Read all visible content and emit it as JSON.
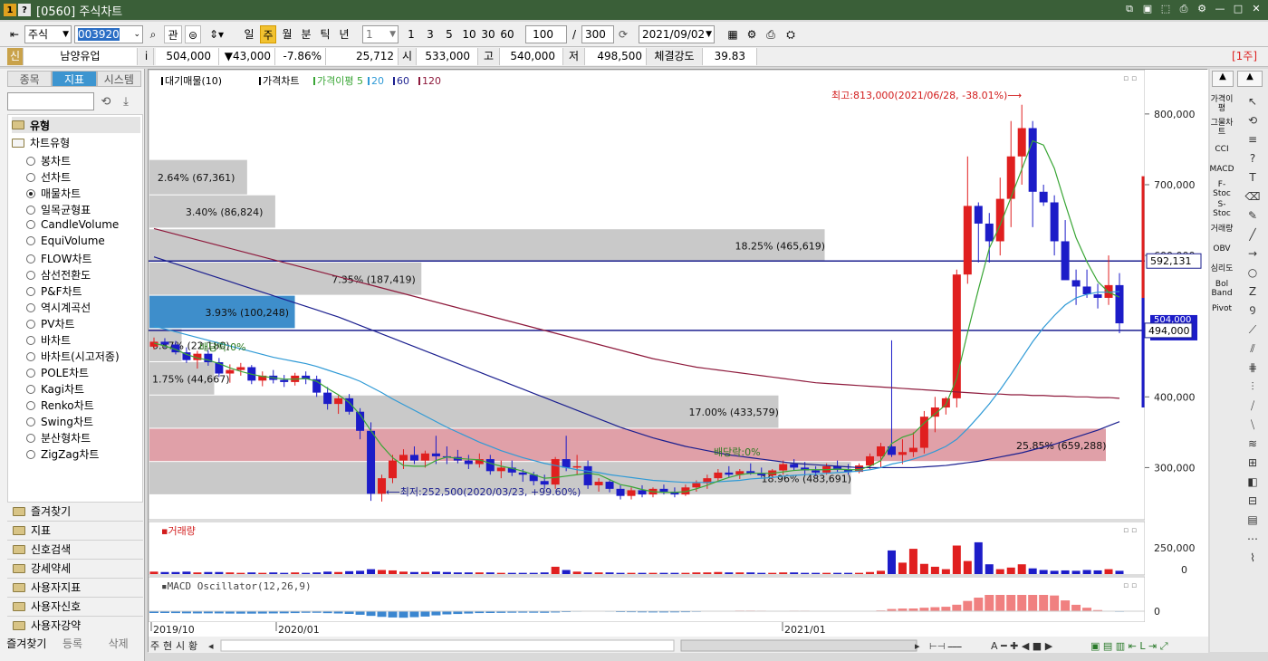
{
  "window": {
    "title": "[0560] 주식차트",
    "num_icons": [
      "1",
      "?"
    ]
  },
  "toolbar": {
    "type_select": "주식",
    "code": "003920",
    "btn_gwan": "관",
    "periods": [
      "일",
      "주",
      "월",
      "분",
      "틱",
      "년"
    ],
    "active_period": "주",
    "period_value": "1",
    "quick": [
      "1",
      "3",
      "5",
      "10",
      "30",
      "60"
    ],
    "count": "100",
    "slash": "/",
    "total": "300",
    "date": "2021/09/02"
  },
  "quote": {
    "tag": "신",
    "name": "남양유업",
    "info": "i",
    "price": "504,000",
    "change": "▼43,000",
    "change_pct": "-7.86%",
    "volume": "25,712",
    "open_lbl": "시",
    "open": "533,000",
    "high_lbl": "고",
    "high": "540,000",
    "low_lbl": "저",
    "low": "498,500",
    "strength_lbl": "체결강도",
    "strength": "39.83",
    "period_badge": "[1주]"
  },
  "left_panel": {
    "tabs": [
      "종목",
      "지표",
      "시스템"
    ],
    "active_tab": "지표",
    "section": "유형",
    "tree_root": "차트유형",
    "items": [
      "봉차트",
      "선차트",
      "매물차트",
      "일목균형표",
      "CandleVolume",
      "EquiVolume",
      "FLOW차트",
      "삼선전환도",
      "P&F차트",
      "역시계곡선",
      "PV차트",
      "바차트",
      "바차트(시고저종)",
      "POLE차트",
      "Kagi차트",
      "Renko차트",
      "Swing차트",
      "분산형차트",
      "ZigZag차트"
    ],
    "selected": "매물차트",
    "folders": [
      "즐겨찾기",
      "지표",
      "신호검색",
      "강세약세",
      "사용자지표",
      "사용자신호",
      "사용자강약"
    ],
    "bottom": [
      "즐겨찾기",
      "등록",
      "삭제"
    ]
  },
  "chart_data": {
    "type": "candlestick",
    "legend": {
      "items": [
        "대기매물(10)",
        "가격차트",
        "가격이평 5",
        "20",
        "60",
        "120"
      ],
      "colors": [
        "#000",
        "#000",
        "#3aa636",
        "#2f9ad6",
        "#1b1f8f",
        "#8e1a3c"
      ]
    },
    "y_ticks": [
      "800,000",
      "700,000",
      "600,000",
      "400,000",
      "300,000"
    ],
    "x_ticks": [
      "2019/10",
      "2020/01",
      "2021/01"
    ],
    "price_range": [
      225000,
      860000
    ],
    "annotations": {
      "high": "최고:813,000(2021/06/28, -38.01%)⟶",
      "low": "⟵최저:252,500(2020/03/23, +99.60%)",
      "div1": "배당락:0%",
      "div2": "배당락:0%"
    },
    "price_markers": {
      "p1": "592,131",
      "p2": "494,000",
      "p3": "504,000",
      "p4": "-7.86%"
    },
    "volume_profile": [
      {
        "label": "2.64% (67,361)",
        "low": 685000,
        "high": 735000,
        "pct": 2.64,
        "color": "#c9c9c9"
      },
      {
        "label": "3.40% (86,824)",
        "low": 638000,
        "high": 685000,
        "pct": 3.4,
        "color": "#c9c9c9"
      },
      {
        "label": "18.25% (465,619)",
        "low": 590000,
        "high": 637000,
        "pct": 18.25,
        "color": "#c9c9c9"
      },
      {
        "label": "7.35% (187,419)",
        "low": 543000,
        "high": 590000,
        "pct": 7.35,
        "color": "#c9c9c9"
      },
      {
        "label": "3.93% (100,248)",
        "low": 496000,
        "high": 543000,
        "pct": 3.93,
        "color": "#3e8ecb"
      },
      {
        "label": "0.87% (22,180)",
        "low": 449000,
        "high": 496000,
        "pct": 0.87,
        "color": "#c9c9c9"
      },
      {
        "label": "1.75% (44,667)",
        "low": 402000,
        "high": 449000,
        "pct": 1.75,
        "color": "#c9c9c9"
      },
      {
        "label": "17.00% (433,579)",
        "low": 355000,
        "high": 402000,
        "pct": 17.0,
        "color": "#c9c9c9"
      },
      {
        "label": "25.85% (659,288)",
        "low": 308000,
        "high": 355000,
        "pct": 25.85,
        "color": "#e0a0a8"
      },
      {
        "label": "18.96% (483,691)",
        "low": 261000,
        "high": 308000,
        "pct": 18.96,
        "color": "#c9c9c9"
      }
    ],
    "candles": [
      [
        471,
        484,
        467,
        478
      ],
      [
        478,
        483,
        469,
        474
      ],
      [
        474,
        479,
        460,
        463
      ],
      [
        463,
        470,
        448,
        452
      ],
      [
        452,
        465,
        440,
        461
      ],
      [
        461,
        466,
        444,
        449
      ],
      [
        449,
        455,
        428,
        433
      ],
      [
        433,
        446,
        420,
        438
      ],
      [
        438,
        448,
        430,
        442
      ],
      [
        442,
        445,
        418,
        423
      ],
      [
        423,
        436,
        415,
        430
      ],
      [
        430,
        438,
        419,
        424
      ],
      [
        424,
        431,
        414,
        421
      ],
      [
        421,
        434,
        416,
        430
      ],
      [
        430,
        436,
        418,
        425
      ],
      [
        425,
        430,
        400,
        406
      ],
      [
        406,
        414,
        382,
        390
      ],
      [
        390,
        402,
        376,
        398
      ],
      [
        398,
        404,
        375,
        379
      ],
      [
        379,
        384,
        340,
        352
      ],
      [
        352,
        364,
        253,
        263
      ],
      [
        263,
        290,
        252,
        285
      ],
      [
        285,
        318,
        278,
        310
      ],
      [
        310,
        326,
        298,
        318
      ],
      [
        318,
        330,
        305,
        310
      ],
      [
        310,
        324,
        300,
        320
      ],
      [
        320,
        345,
        305,
        316
      ],
      [
        316,
        330,
        305,
        315
      ],
      [
        315,
        325,
        306,
        310
      ],
      [
        310,
        318,
        298,
        305
      ],
      [
        305,
        320,
        300,
        312
      ],
      [
        312,
        318,
        290,
        295
      ],
      [
        295,
        310,
        285,
        300
      ],
      [
        300,
        310,
        288,
        293
      ],
      [
        293,
        298,
        280,
        290
      ],
      [
        290,
        294,
        275,
        281
      ],
      [
        281,
        290,
        270,
        276
      ],
      [
        276,
        315,
        270,
        312
      ],
      [
        312,
        345,
        295,
        300
      ],
      [
        300,
        318,
        290,
        302
      ],
      [
        302,
        310,
        270,
        275
      ],
      [
        275,
        285,
        266,
        280
      ],
      [
        280,
        282,
        265,
        270
      ],
      [
        270,
        275,
        255,
        260
      ],
      [
        260,
        272,
        255,
        268
      ],
      [
        268,
        275,
        258,
        262
      ],
      [
        262,
        272,
        258,
        270
      ],
      [
        270,
        276,
        262,
        266
      ],
      [
        266,
        272,
        258,
        262
      ],
      [
        262,
        276,
        260,
        272
      ],
      [
        272,
        282,
        266,
        278
      ],
      [
        278,
        290,
        270,
        285
      ],
      [
        285,
        298,
        280,
        293
      ],
      [
        293,
        302,
        286,
        290
      ],
      [
        290,
        298,
        284,
        295
      ],
      [
        295,
        306,
        290,
        292
      ],
      [
        292,
        300,
        286,
        289
      ],
      [
        289,
        298,
        284,
        296
      ],
      [
        296,
        310,
        290,
        305
      ],
      [
        305,
        312,
        296,
        300
      ],
      [
        300,
        308,
        290,
        296
      ],
      [
        296,
        302,
        288,
        293
      ],
      [
        293,
        306,
        290,
        302
      ],
      [
        302,
        310,
        294,
        297
      ],
      [
        297,
        305,
        290,
        294
      ],
      [
        294,
        306,
        292,
        303
      ],
      [
        303,
        320,
        298,
        316
      ],
      [
        316,
        335,
        300,
        330
      ],
      [
        330,
        480,
        315,
        318
      ],
      [
        318,
        340,
        305,
        322
      ],
      [
        322,
        350,
        315,
        328
      ],
      [
        328,
        380,
        320,
        372
      ],
      [
        372,
        400,
        350,
        385
      ],
      [
        385,
        400,
        375,
        398
      ],
      [
        398,
        580,
        385,
        573
      ],
      [
        573,
        740,
        560,
        670
      ],
      [
        670,
        675,
        590,
        645
      ],
      [
        645,
        660,
        590,
        620
      ],
      [
        620,
        710,
        600,
        680
      ],
      [
        680,
        790,
        640,
        740
      ],
      [
        740,
        813,
        700,
        780
      ],
      [
        780,
        790,
        640,
        690
      ],
      [
        690,
        700,
        670,
        675
      ],
      [
        675,
        685,
        600,
        620
      ],
      [
        620,
        650,
        575,
        565
      ],
      [
        565,
        580,
        530,
        556
      ],
      [
        556,
        580,
        540,
        545
      ],
      [
        545,
        560,
        525,
        540
      ],
      [
        540,
        600,
        530,
        558
      ],
      [
        558,
        575,
        490,
        504
      ]
    ],
    "ma5": [
      476,
      472,
      467,
      460,
      455,
      452,
      447,
      441,
      436,
      432,
      429,
      427,
      425,
      425,
      426,
      422,
      412,
      403,
      392,
      375,
      352,
      331,
      314,
      303,
      302,
      302,
      310,
      315,
      313,
      312,
      311,
      306,
      302,
      299,
      295,
      290,
      285,
      286,
      288,
      290,
      292,
      290,
      283,
      276,
      273,
      269,
      266,
      265,
      265,
      266,
      270,
      275,
      281,
      286,
      290,
      292,
      292,
      292,
      294,
      296,
      297,
      297,
      297,
      298,
      297,
      297,
      302,
      310,
      334,
      343,
      348,
      363,
      376,
      389,
      426,
      491,
      552,
      610,
      643,
      682,
      722,
      762,
      756,
      723,
      673,
      625,
      591,
      563,
      548,
      541
    ],
    "ma20": [
      500,
      496,
      492,
      488,
      484,
      480,
      476,
      472,
      468,
      464,
      460,
      456,
      453,
      450,
      447,
      443,
      438,
      433,
      428,
      422,
      414,
      406,
      397,
      389,
      381,
      373,
      365,
      357,
      350,
      343,
      336,
      330,
      324,
      319,
      314,
      310,
      306,
      303,
      300,
      297,
      295,
      293,
      290,
      288,
      286,
      284,
      282,
      281,
      280,
      279,
      279,
      279,
      280,
      281,
      282,
      284,
      285,
      286,
      288,
      289,
      290,
      291,
      292,
      293,
      294,
      295,
      297,
      300,
      305,
      308,
      312,
      317,
      323,
      330,
      340,
      355,
      372,
      390,
      410,
      432,
      455,
      478,
      498,
      515,
      530,
      540,
      545,
      548,
      548,
      549
    ],
    "ma60": [
      598,
      593,
      588,
      583,
      578,
      573,
      568,
      563,
      558,
      553,
      548,
      543,
      538,
      533,
      528,
      523,
      518,
      513,
      507,
      501,
      495,
      489,
      483,
      477,
      471,
      465,
      459,
      453,
      447,
      441,
      435,
      429,
      423,
      417,
      411,
      405,
      399,
      393,
      387,
      381,
      375,
      369,
      363,
      357,
      352,
      347,
      342,
      338,
      334,
      330,
      327,
      324,
      321,
      318,
      316,
      314,
      312,
      310,
      308,
      306,
      305,
      304,
      303,
      302,
      301,
      300,
      300,
      300,
      300,
      300,
      300,
      301,
      302,
      303,
      305,
      307,
      309,
      312,
      315,
      318,
      321,
      325,
      329,
      333,
      338,
      343,
      348,
      353,
      359,
      365
    ],
    "ma120": [
      638,
      634,
      630,
      626,
      622,
      618,
      614,
      610,
      606,
      602,
      598,
      594,
      590,
      586,
      582,
      578,
      574,
      570,
      566,
      562,
      558,
      554,
      550,
      546,
      542,
      538,
      534,
      530,
      526,
      522,
      518,
      514,
      510,
      506,
      502,
      498,
      494,
      490,
      486,
      482,
      478,
      474,
      470,
      466,
      462,
      458,
      454,
      451,
      448,
      445,
      442,
      440,
      438,
      436,
      434,
      432,
      430,
      428,
      426,
      424,
      422,
      420,
      419,
      418,
      417,
      416,
      415,
      414,
      413,
      412,
      411,
      410,
      409,
      408,
      407,
      406,
      405,
      404,
      404,
      403,
      403,
      402,
      402,
      401,
      401,
      400,
      400,
      399,
      399,
      398
    ],
    "volume_panel": {
      "title": "거래량",
      "ticks": [
        "250,000",
        "0"
      ],
      "values": [
        6,
        5,
        5,
        6,
        4,
        5,
        5,
        4,
        3,
        4,
        3,
        4,
        3,
        4,
        3,
        4,
        6,
        5,
        7,
        8,
        12,
        10,
        9,
        6,
        5,
        5,
        6,
        5,
        4,
        4,
        4,
        4,
        3,
        3,
        3,
        3,
        4,
        18,
        10,
        6,
        4,
        4,
        4,
        3,
        3,
        3,
        3,
        3,
        3,
        3,
        4,
        4,
        5,
        4,
        4,
        4,
        3,
        3,
        4,
        4,
        3,
        3,
        3,
        3,
        3,
        3,
        5,
        8,
        58,
        28,
        62,
        25,
        18,
        12,
        70,
        32,
        78,
        24,
        12,
        16,
        24,
        14,
        10,
        8,
        9,
        8,
        10,
        9,
        12,
        8
      ]
    },
    "macd_panel": {
      "title": "MACD Oscillator(12,26,9)",
      "ticks": [
        "0"
      ]
    }
  },
  "right_tools": {
    "col1": [
      "가격이평",
      "그물차트",
      "CCI",
      "MACD",
      "F-Stoc",
      "S-Stoc",
      "거래량",
      "OBV",
      "심리도",
      "Bol Band",
      "Pivot"
    ]
  }
}
